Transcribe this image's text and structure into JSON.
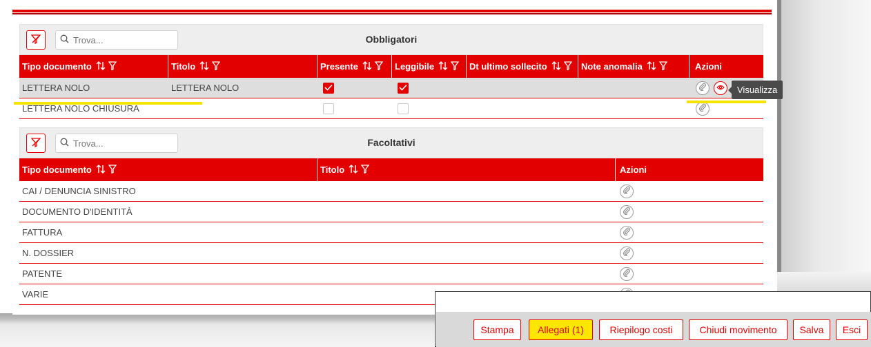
{
  "obbligatori": {
    "search_placeholder": "Trova...",
    "title": "Obbligatori",
    "columns": [
      {
        "label": "Tipo documento"
      },
      {
        "label": "Titolo"
      },
      {
        "label": "Presente"
      },
      {
        "label": "Leggibile"
      },
      {
        "label": "Dt ultimo sollecito"
      },
      {
        "label": "Note anomalia"
      },
      {
        "label": "Azioni"
      }
    ],
    "rows": [
      {
        "tipo": "LETTERA NOLO",
        "titolo": "LETTERA NOLO",
        "presente": true,
        "leggibile": true,
        "selected": true
      },
      {
        "tipo": "LETTERA NOLO CHIUSURA",
        "titolo": "",
        "presente": false,
        "leggibile": false,
        "selected": false
      }
    ]
  },
  "facoltativi": {
    "search_placeholder": "Trova...",
    "title": "Facoltativi",
    "columns": [
      {
        "label": "Tipo documento"
      },
      {
        "label": "Titolo"
      },
      {
        "label": "Azioni"
      }
    ],
    "rows": [
      {
        "tipo": "CAI / DENUNCIA SINISTRO"
      },
      {
        "tipo": "DOCUMENTO D'IDENTITÀ"
      },
      {
        "tipo": "FATTURA"
      },
      {
        "tipo": "N. DOSSIER"
      },
      {
        "tipo": "PATENTE"
      },
      {
        "tipo": "VARIE"
      }
    ]
  },
  "tooltip": "Visualizza",
  "actions": {
    "stampa": "Stampa",
    "allegati": "Allegati (1)",
    "riepilogo": "Riepilogo costi",
    "chiudi": "Chiudi movimento",
    "salva": "Salva",
    "esci": "Esci"
  },
  "colors": {
    "accent": "#e30000",
    "header_bg": "#eeeeee",
    "selected_row": "#dedede",
    "highlight": "#ffe600"
  },
  "icons": [
    "filter-clear-icon",
    "search-icon",
    "sort-icon",
    "filter-icon",
    "checkmark-icon",
    "paperclip-icon",
    "eye-icon"
  ]
}
